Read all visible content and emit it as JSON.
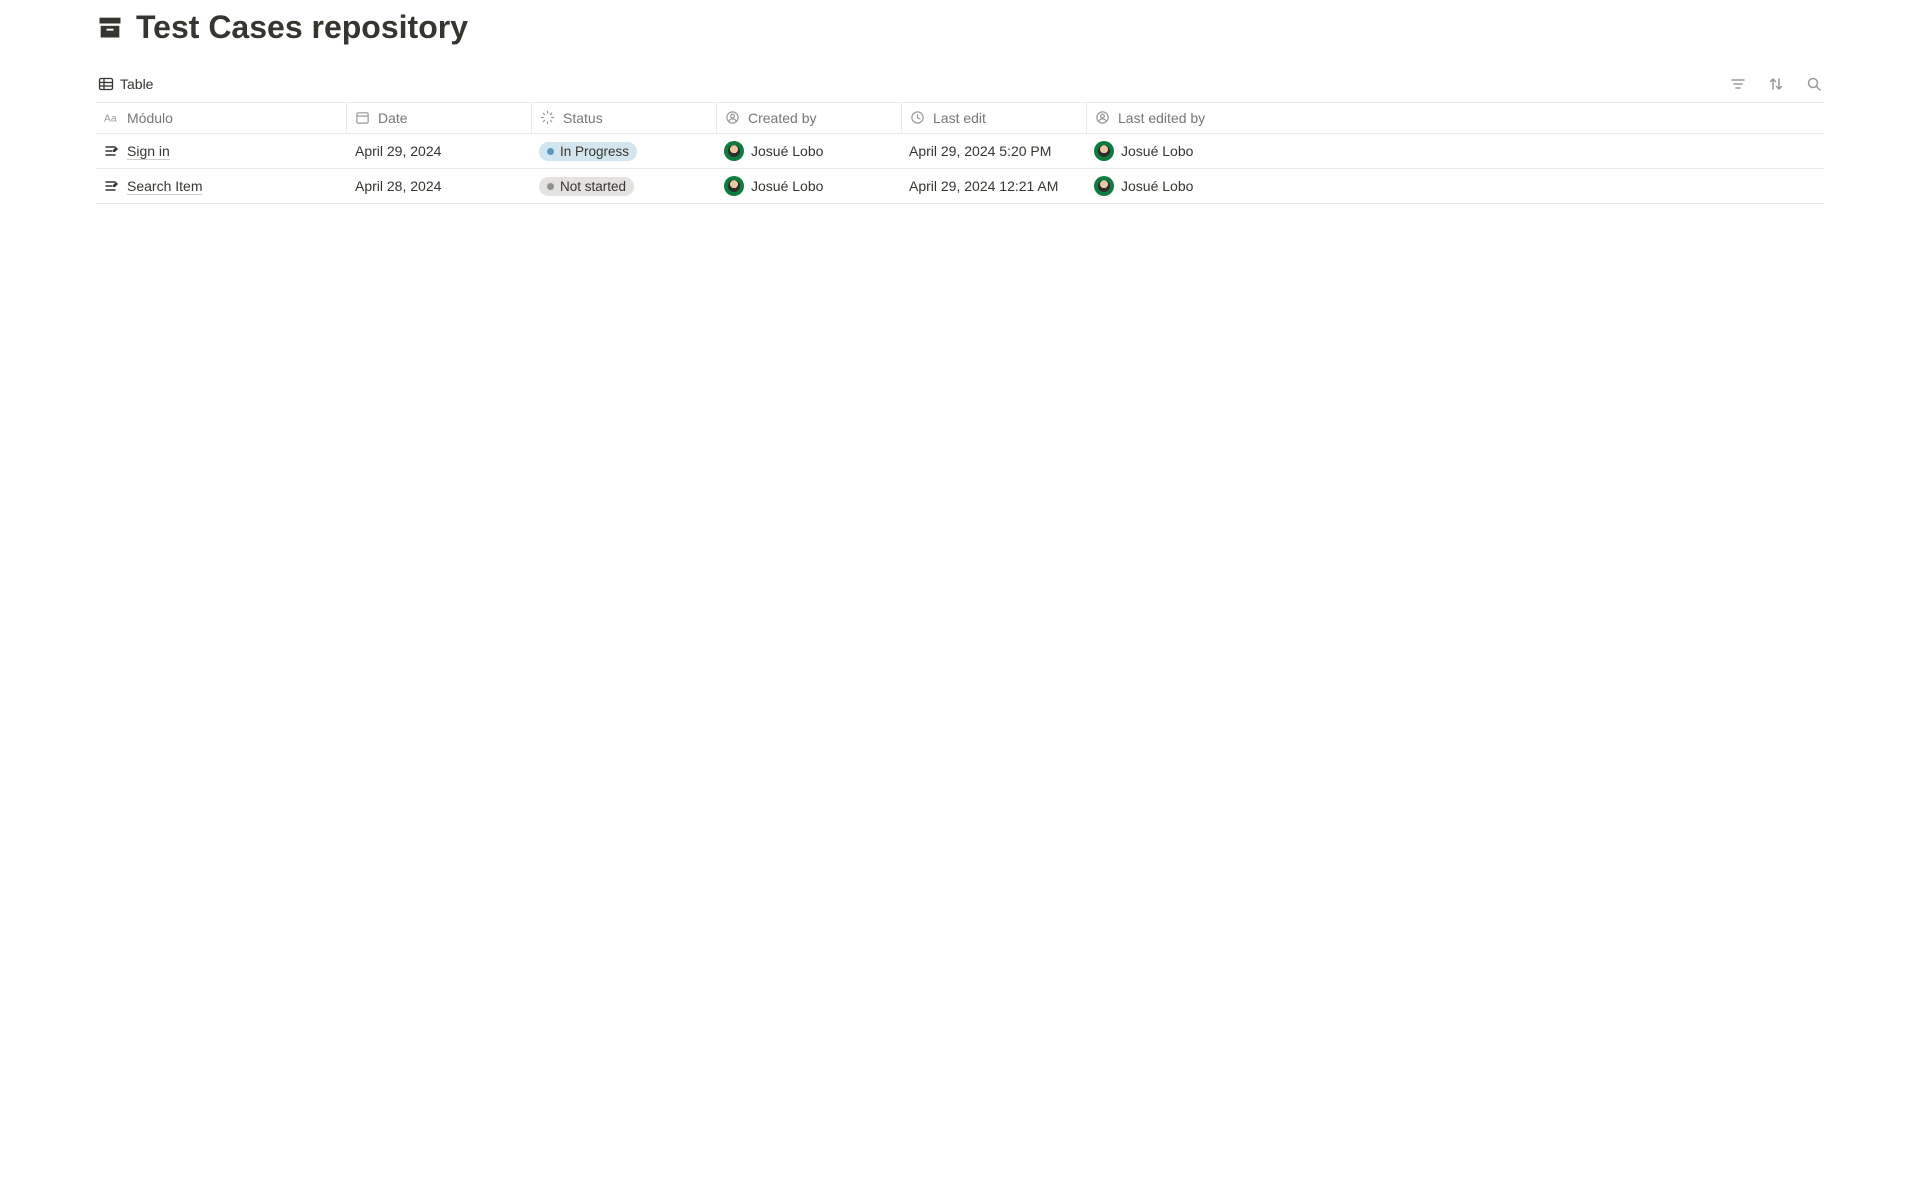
{
  "page": {
    "title": "Test Cases repository"
  },
  "view": {
    "tab_label": "Table"
  },
  "columns": {
    "modulo": "Módulo",
    "date": "Date",
    "status": "Status",
    "created_by": "Created by",
    "last_edit": "Last edit",
    "last_edited_by": "Last edited by"
  },
  "rows": [
    {
      "title": "Sign in",
      "date": "April 29, 2024",
      "status_label": "In Progress",
      "status_class": "in-progress",
      "created_by": "Josué Lobo",
      "last_edit": "April 29, 2024 5:20 PM",
      "last_edited_by": "Josué Lobo"
    },
    {
      "title": "Search Item",
      "date": "April 28, 2024",
      "status_label": "Not started",
      "status_class": "not-started",
      "created_by": "Josué Lobo",
      "last_edit": "April 29, 2024 12:21 AM",
      "last_edited_by": "Josué Lobo"
    }
  ]
}
